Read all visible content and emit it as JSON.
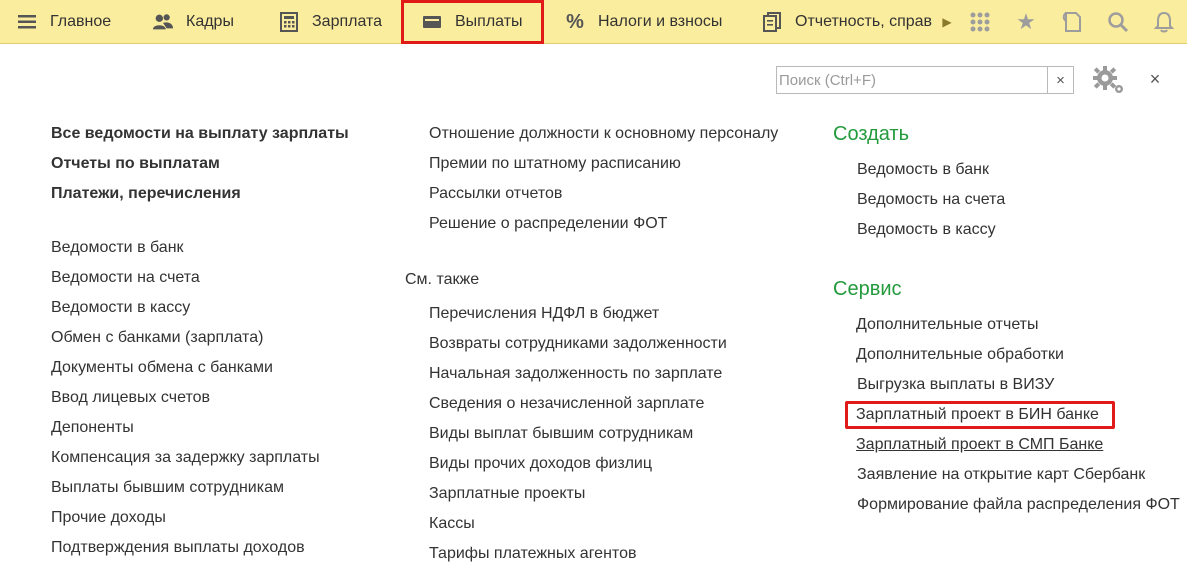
{
  "topbar": {
    "tabs": [
      {
        "label": "Главное",
        "icon": "menu-icon"
      },
      {
        "label": "Кадры",
        "icon": "people-icon"
      },
      {
        "label": "Зарплата",
        "icon": "calculator-icon"
      },
      {
        "label": "Выплаты",
        "icon": "wallet-icon"
      },
      {
        "label": "Налоги и взносы",
        "icon": "percent-icon"
      },
      {
        "label": "Отчетность, справ",
        "icon": "documents-icon"
      }
    ],
    "right_icons": [
      "more-arrow-icon",
      "apps-grid-icon",
      "star-icon",
      "history-icon",
      "search-icon",
      "bell-icon"
    ]
  },
  "search": {
    "placeholder": "Поиск (Ctrl+F)",
    "clear": "×"
  },
  "close": "×",
  "col1": {
    "bold_links": [
      "Все ведомости на выплату зарплаты",
      "Отчеты по выплатам",
      "Платежи, перечисления"
    ],
    "links": [
      "Ведомости в банк",
      "Ведомости на счета",
      "Ведомости в кассу",
      "Обмен с банками (зарплата)",
      "Документы обмена с банками",
      "Ввод лицевых счетов",
      "Депоненты",
      "Компенсация за задержку зарплаты",
      "Выплаты бывшим сотрудникам",
      "Прочие доходы",
      "Подтверждения выплаты доходов"
    ]
  },
  "col2": {
    "links": [
      "Отношение должности к основному персоналу",
      "Премии по штатному расписанию",
      "Рассылки отчетов",
      "Решение о распределении ФОТ"
    ],
    "see_also_title": "См. также",
    "see_also": [
      "Перечисления НДФЛ в бюджет",
      "Возвраты сотрудниками задолженности",
      "Начальная задолженность по зарплате",
      "Сведения о незачисленной зарплате",
      "Виды выплат бывшим сотрудникам",
      "Виды прочих доходов физлиц",
      "Зарплатные проекты",
      "Кассы",
      "Тарифы платежных агентов"
    ]
  },
  "col3": {
    "create_title": "Создать",
    "create": [
      "Ведомость в банк",
      "Ведомость на счета",
      "Ведомость в кассу"
    ],
    "service_title": "Сервис",
    "service": [
      "Дополнительные отчеты",
      "Дополнительные обработки",
      "Выгрузка выплаты в ВИЗУ",
      "Зарплатный проект в БИН банке",
      "Зарплатный проект в СМП Банке",
      "Заявление на открытие карт Сбербанк",
      "Формирование файла распределения ФОТ"
    ]
  },
  "colors": {
    "topbar": "#fbed9e",
    "section_green": "#239a3c",
    "highlight_red": "#e01919"
  }
}
